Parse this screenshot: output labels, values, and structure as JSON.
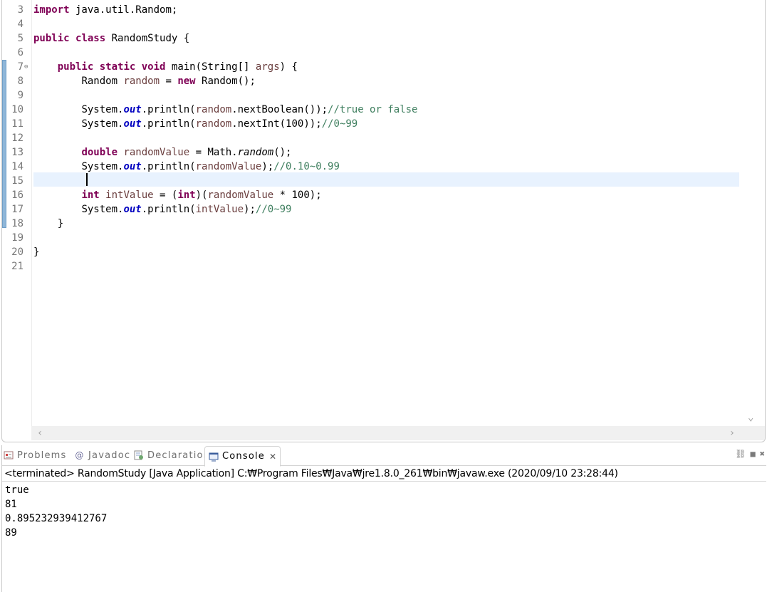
{
  "editor": {
    "line_numbers": [
      "3",
      "4",
      "5",
      "6",
      "7",
      "8",
      "9",
      "10",
      "11",
      "12",
      "13",
      "14",
      "15",
      "16",
      "17",
      "18",
      "19",
      "20",
      "21"
    ],
    "fold_icon": "⊖",
    "lines": {
      "l3": {
        "kw": "import",
        "rest": " java.util.Random;"
      },
      "l5": {
        "kw1": "public",
        "kw2": "class",
        "rest": " RandomStudy {"
      },
      "l7": {
        "kw1": "public",
        "kw2": "static",
        "kw3": "void",
        "a": " main(String[] ",
        "param": "args",
        "b": ") {"
      },
      "l8": {
        "type": "Random ",
        "var": "random",
        "eq": " = ",
        "kw": "new",
        "rest": " Random();"
      },
      "l10": {
        "a": "System.",
        "fld": "out",
        "b": ".println(",
        "var": "random",
        "c": ".nextBoolean());",
        "cm": "//true or false"
      },
      "l11": {
        "a": "System.",
        "fld": "out",
        "b": ".println(",
        "var": "random",
        "c": ".nextInt(100));",
        "cm": "//0~99"
      },
      "l13": {
        "kw": "double",
        "sp": " ",
        "var": "randomValue",
        "a": " = Math.",
        "it": "random",
        "b": "();"
      },
      "l14": {
        "a": "System.",
        "fld": "out",
        "b": ".println(",
        "var": "randomValue",
        "c": ");",
        "cm": "//0.10~0.99"
      },
      "l16": {
        "kw": "int",
        "sp": " ",
        "var": "intValue",
        "a": " = (",
        "kw2": "int",
        "b": ")(",
        "var2": "randomValue",
        "c": " * 100);"
      },
      "l17": {
        "a": "System.",
        "fld": "out",
        "b": ".println(",
        "var": "intValue",
        "c": ");",
        "cm": "//0~99"
      },
      "l18": "}",
      "l20": "}"
    }
  },
  "views": {
    "tabs": [
      {
        "label": "Problems",
        "icon": "problems-icon"
      },
      {
        "label": "Javadoc",
        "icon": "javadoc-icon"
      },
      {
        "label": "Declaration",
        "icon": "declaration-icon"
      },
      {
        "label": "Console",
        "icon": "console-icon",
        "active": true
      }
    ],
    "close_glyph": "✕",
    "status": "<terminated> RandomStudy [Java Application] C:₩Program Files₩Java₩jre1.8.0_261₩bin₩javaw.exe (2020/09/10 23:28:44)",
    "output": [
      "true",
      "81",
      "0.895232939412767",
      "89"
    ]
  },
  "colors": {
    "keyword": "#7f0055",
    "field": "#0000c0",
    "local_var": "#6a3e3e",
    "comment": "#3f7f5f",
    "current_line": "#e8f2fe"
  }
}
